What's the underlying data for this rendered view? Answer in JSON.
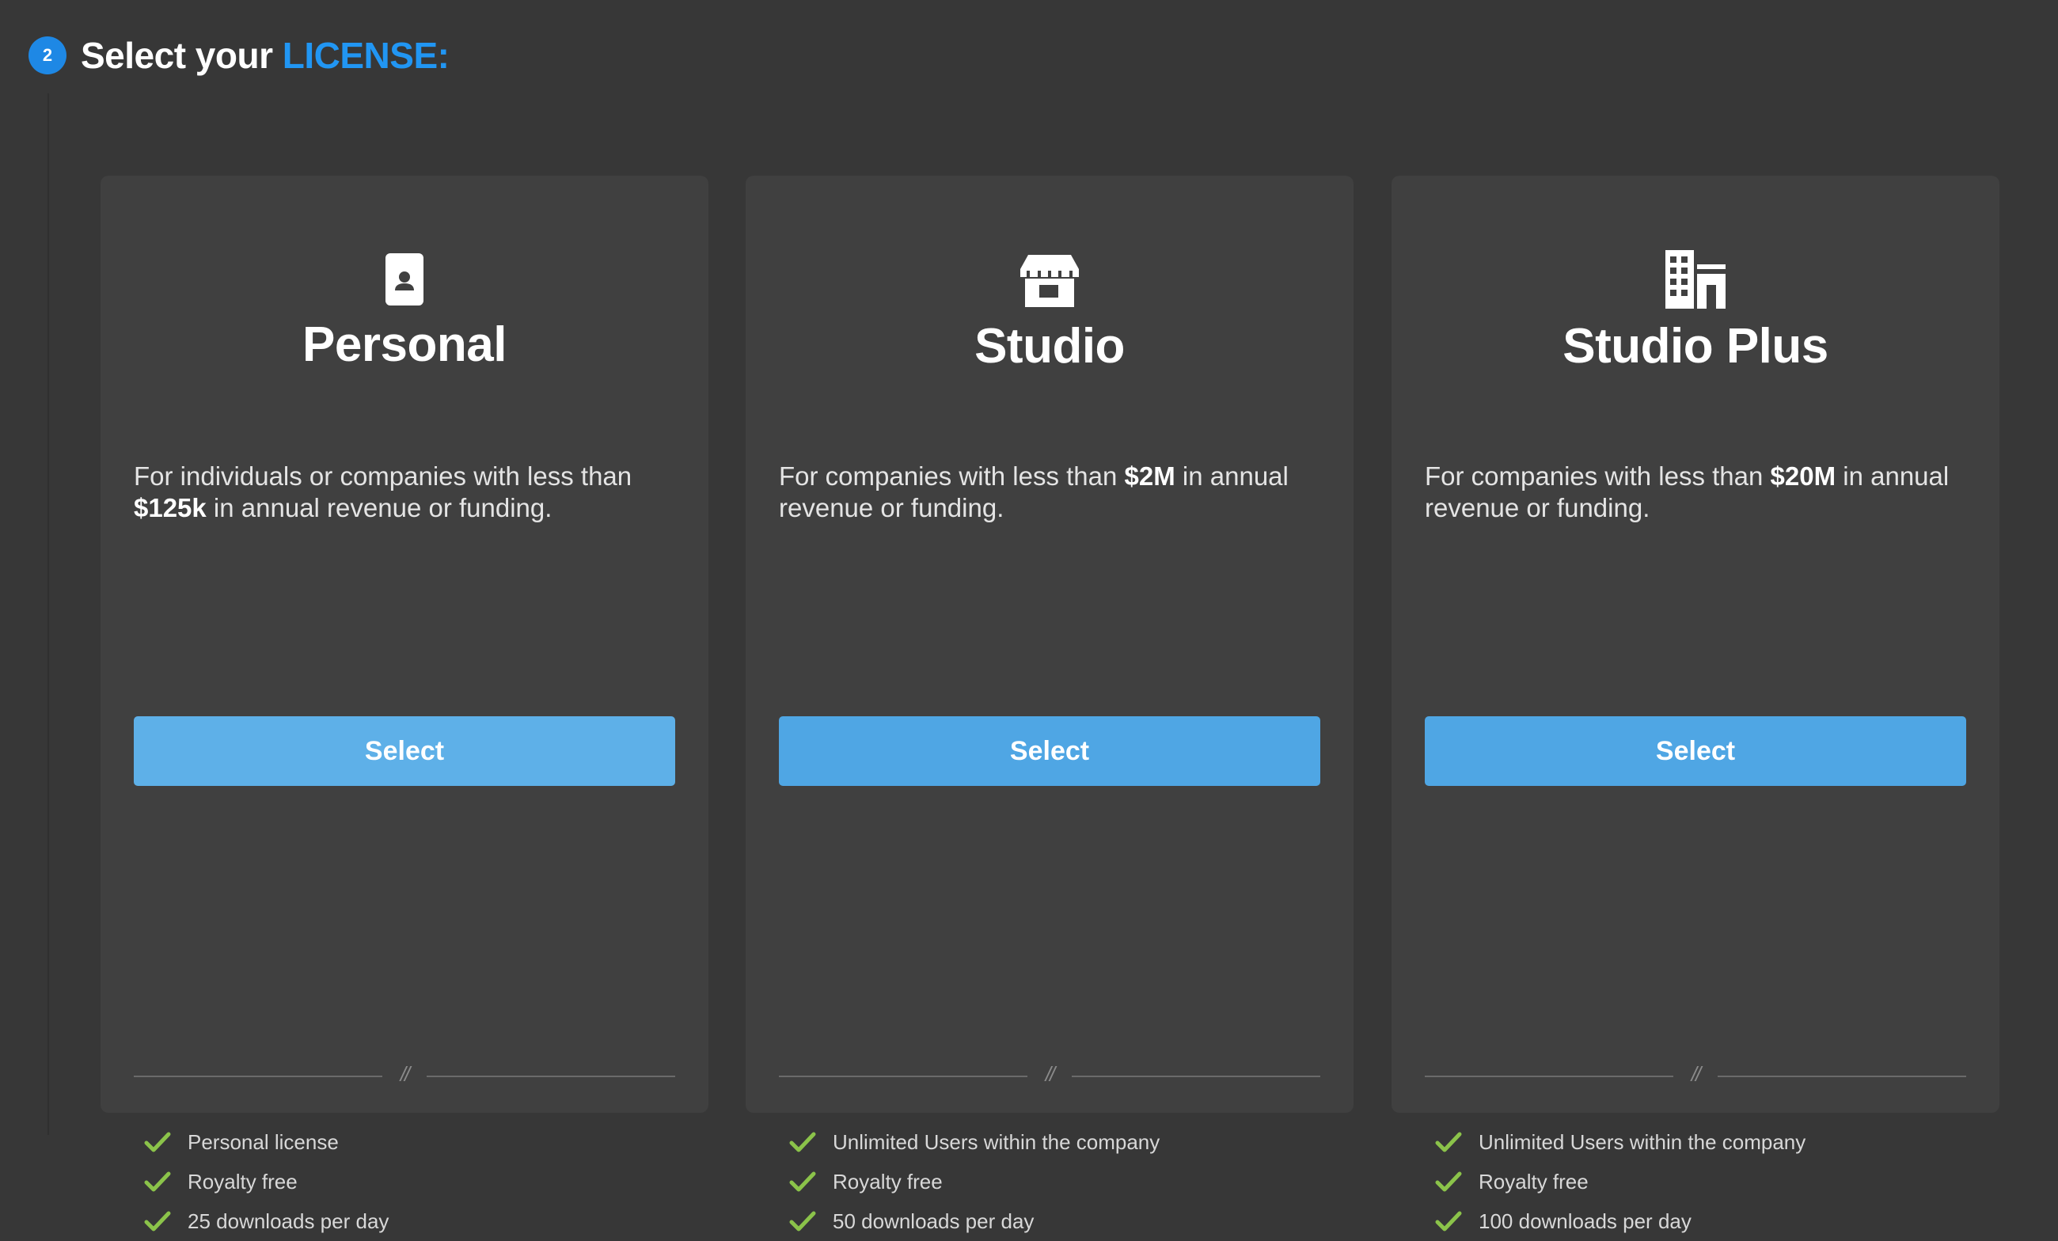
{
  "step": {
    "number": "2",
    "title_prefix": "Select your ",
    "title_accent": "LICENSE:"
  },
  "colors": {
    "background": "#373737",
    "card": "#404040",
    "accent": "#2196f3",
    "button": "#4fa6e4",
    "check": "#8bc34a"
  },
  "plans": [
    {
      "icon": "id-card-icon",
      "name": "Personal",
      "desc_pre": "For individuals or companies with less than ",
      "desc_bold": "$125k",
      "desc_post": " in annual revenue or funding.",
      "button_label": "Select",
      "divider_mark": "//",
      "features": [
        "Personal license",
        "Royalty free",
        "25 downloads per day"
      ]
    },
    {
      "icon": "store-icon",
      "name": "Studio",
      "desc_pre": "For companies with less than ",
      "desc_bold": "$2M",
      "desc_post": " in annual revenue or funding.",
      "button_label": "Select",
      "divider_mark": "//",
      "features": [
        "Unlimited Users within the company",
        "Royalty free",
        "50 downloads per day"
      ]
    },
    {
      "icon": "building-icon",
      "name": "Studio Plus",
      "desc_pre": "For companies with less than ",
      "desc_bold": "$20M",
      "desc_post": " in annual revenue or funding.",
      "button_label": "Select",
      "divider_mark": "//",
      "features": [
        "Unlimited Users within the company",
        "Royalty free",
        "100 downloads per day"
      ]
    }
  ]
}
